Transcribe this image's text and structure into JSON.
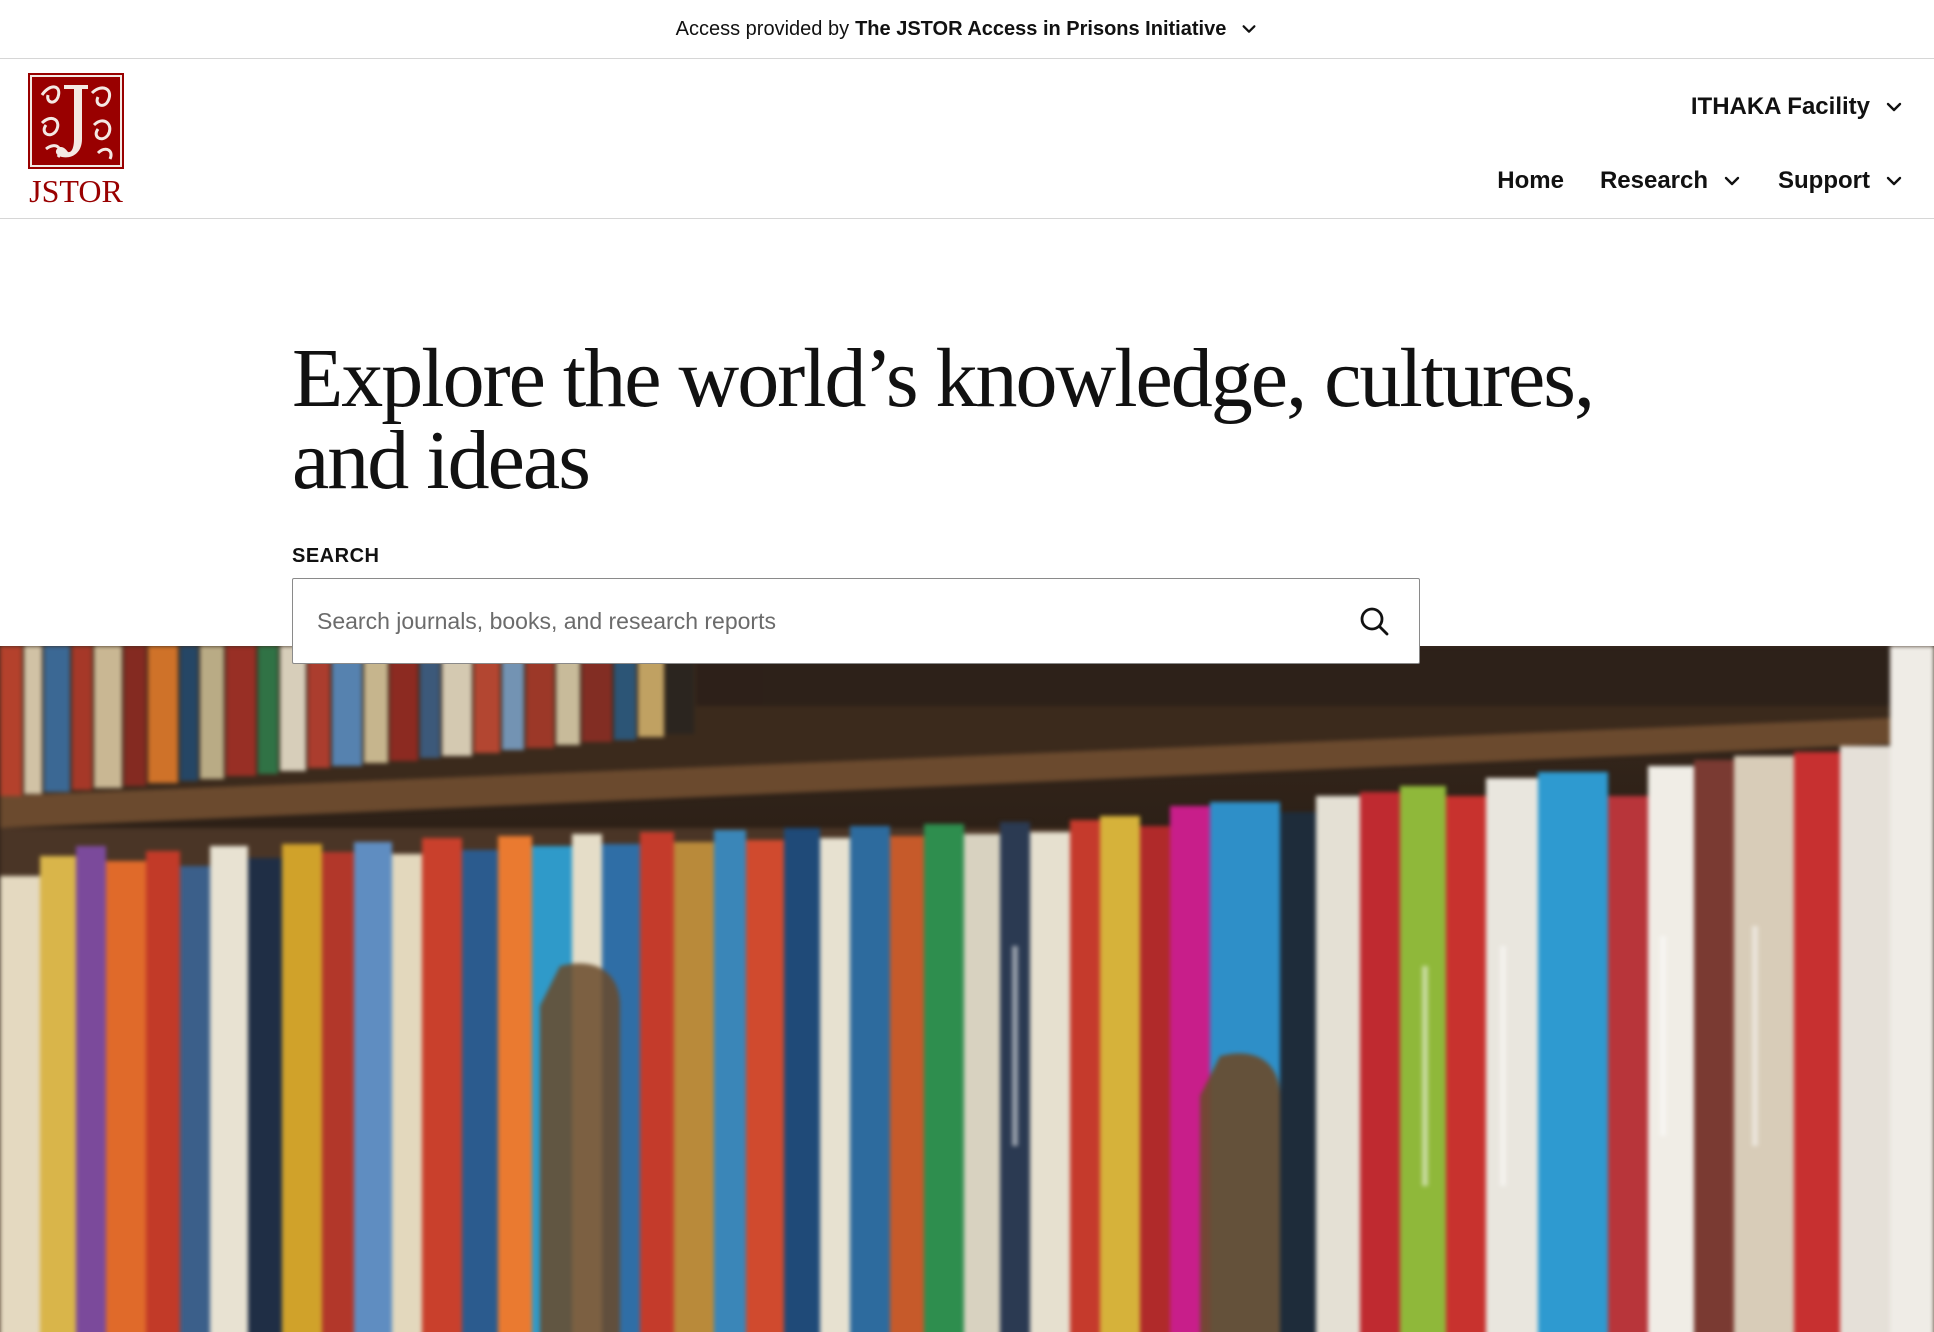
{
  "access_banner": {
    "prefix": "Access provided by",
    "organization": "The JSTOR Access in Prisons Initiative"
  },
  "header": {
    "logo_text": "JSTOR",
    "facility_label": "ITHAKA Facility",
    "nav": {
      "home": "Home",
      "research": "Research",
      "support": "Support"
    }
  },
  "hero": {
    "title_line1": "Explore the world’s knowledge, cultures,",
    "title_line2": "and ideas",
    "search_label": "SEARCH",
    "search_placeholder": "Search journals, books, and research reports",
    "search_value": ""
  },
  "icons": {
    "banner_toggle": "chevron-down-icon",
    "facility_toggle": "chevron-down-icon",
    "research_toggle": "chevron-down-icon",
    "support_toggle": "chevron-down-icon",
    "search": "search-icon",
    "logo": "jstor-logo-icon"
  },
  "colors": {
    "brand": "#990000",
    "text": "#111111",
    "border": "#d6d6d6",
    "placeholder": "#6b6b6b"
  }
}
